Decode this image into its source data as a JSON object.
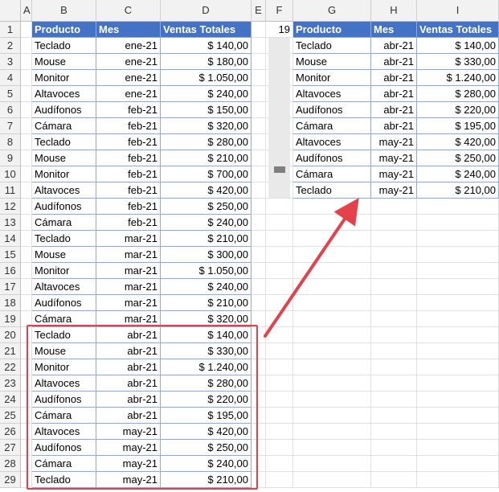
{
  "columns": [
    "A",
    "B",
    "C",
    "D",
    "E",
    "F",
    "G",
    "H",
    "I"
  ],
  "rows": [
    "1",
    "2",
    "3",
    "4",
    "5",
    "6",
    "7",
    "8",
    "9",
    "10",
    "11",
    "12",
    "13",
    "14",
    "15",
    "16",
    "17",
    "18",
    "19",
    "20",
    "21",
    "22",
    "23",
    "24",
    "25",
    "26",
    "27",
    "28",
    "29"
  ],
  "source_table": {
    "headers": [
      "Producto",
      "Mes",
      "Ventas Totales"
    ],
    "rows": [
      [
        "Teclado",
        "ene-21",
        "$ 140,00"
      ],
      [
        "Mouse",
        "ene-21",
        "$ 180,00"
      ],
      [
        "Monitor",
        "ene-21",
        "$ 1.050,00"
      ],
      [
        "Altavoces",
        "ene-21",
        "$ 240,00"
      ],
      [
        "Audífonos",
        "feb-21",
        "$ 150,00"
      ],
      [
        "Cámara",
        "feb-21",
        "$ 320,00"
      ],
      [
        "Teclado",
        "feb-21",
        "$ 280,00"
      ],
      [
        "Mouse",
        "feb-21",
        "$ 210,00"
      ],
      [
        "Monitor",
        "feb-21",
        "$ 700,00"
      ],
      [
        "Altavoces",
        "feb-21",
        "$ 420,00"
      ],
      [
        "Audífonos",
        "feb-21",
        "$ 250,00"
      ],
      [
        "Cámara",
        "feb-21",
        "$ 240,00"
      ],
      [
        "Teclado",
        "mar-21",
        "$ 210,00"
      ],
      [
        "Mouse",
        "mar-21",
        "$ 300,00"
      ],
      [
        "Monitor",
        "mar-21",
        "$ 1.050,00"
      ],
      [
        "Altavoces",
        "mar-21",
        "$ 240,00"
      ],
      [
        "Audífonos",
        "mar-21",
        "$ 210,00"
      ],
      [
        "Cámara",
        "mar-21",
        "$ 320,00"
      ],
      [
        "Teclado",
        "abr-21",
        "$ 140,00"
      ],
      [
        "Mouse",
        "abr-21",
        "$ 330,00"
      ],
      [
        "Monitor",
        "abr-21",
        "$ 1.240,00"
      ],
      [
        "Altavoces",
        "abr-21",
        "$ 280,00"
      ],
      [
        "Audífonos",
        "abr-21",
        "$ 220,00"
      ],
      [
        "Cámara",
        "abr-21",
        "$ 195,00"
      ],
      [
        "Altavoces",
        "may-21",
        "$ 420,00"
      ],
      [
        "Audífonos",
        "may-21",
        "$ 250,00"
      ],
      [
        "Cámara",
        "may-21",
        "$ 240,00"
      ],
      [
        "Teclado",
        "may-21",
        "$ 210,00"
      ]
    ]
  },
  "scrollbar": {
    "value": "19"
  },
  "result_table": {
    "headers": [
      "Producto",
      "Mes",
      "Ventas Totales"
    ],
    "rows": [
      [
        "Teclado",
        "abr-21",
        "$ 140,00"
      ],
      [
        "Mouse",
        "abr-21",
        "$ 330,00"
      ],
      [
        "Monitor",
        "abr-21",
        "$ 1.240,00"
      ],
      [
        "Altavoces",
        "abr-21",
        "$ 280,00"
      ],
      [
        "Audífonos",
        "abr-21",
        "$ 220,00"
      ],
      [
        "Cámara",
        "abr-21",
        "$ 195,00"
      ],
      [
        "Altavoces",
        "may-21",
        "$ 420,00"
      ],
      [
        "Audífonos",
        "may-21",
        "$ 250,00"
      ],
      [
        "Cámara",
        "may-21",
        "$ 240,00"
      ],
      [
        "Teclado",
        "may-21",
        "$ 210,00"
      ]
    ]
  },
  "colors": {
    "header_fill": "#4472c4",
    "highlight": "#e3424b",
    "arrow": "#e3424b"
  }
}
